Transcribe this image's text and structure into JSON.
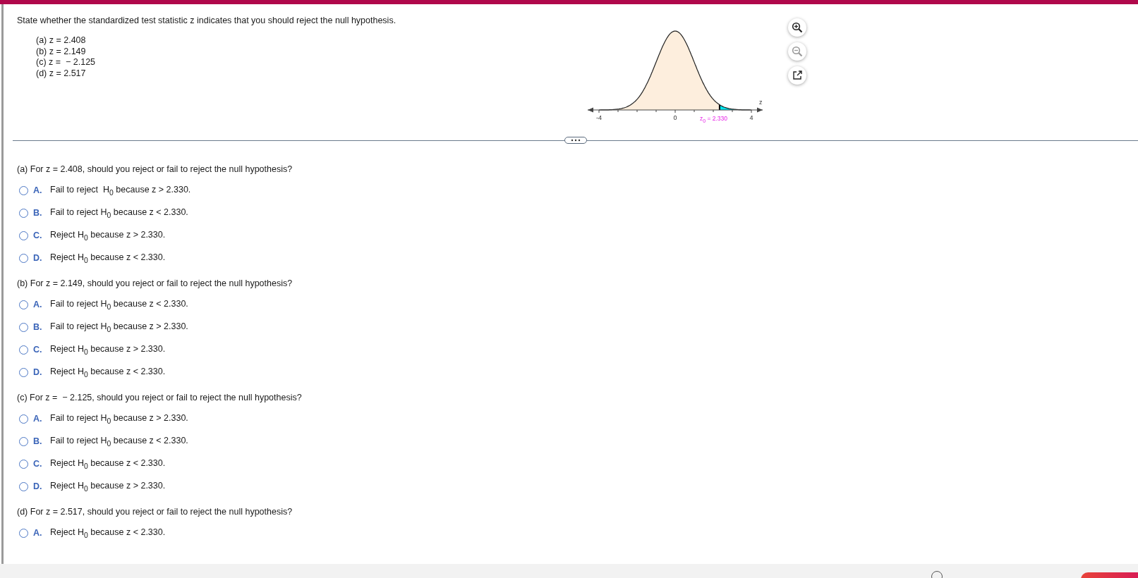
{
  "prompt": "State whether the standardized test statistic z indicates that you should reject the null hypothesis.",
  "given": [
    "(a) z = 2.408",
    "(b) z = 2.149",
    "(c) z =  − 2.125",
    "(d) z = 2.517"
  ],
  "figure": {
    "tick_labels": [
      "-4",
      "0",
      "4"
    ],
    "axis_label": "z",
    "critical_label": "z$_{0}$ = 2.330"
  },
  "tools": [
    {
      "kind": "zoom-in"
    },
    {
      "kind": "zoom-out"
    },
    {
      "kind": "popout"
    }
  ],
  "questions": [
    {
      "text": "(a) For z = 2.408, should you reject or fail to reject the null hypothesis?",
      "options": [
        {
          "letter": "A.",
          "text": "Fail to reject  H$_{0}$ because z > 2.330.",
          "selected": false
        },
        {
          "letter": "B.",
          "text": "Fail to reject H$_{0}$ because z < 2.330.",
          "selected": false
        },
        {
          "letter": "C.",
          "text": "Reject H$_{0}$ because z > 2.330.",
          "selected": false
        },
        {
          "letter": "D.",
          "text": "Reject H$_{0}$ because z < 2.330.",
          "selected": false
        }
      ]
    },
    {
      "text": "(b) For z = 2.149, should you reject or fail to reject the null hypothesis?",
      "options": [
        {
          "letter": "A.",
          "text": "Fail to reject H$_{0}$ because z < 2.330.",
          "selected": false
        },
        {
          "letter": "B.",
          "text": "Fail to reject H$_{0}$ because z > 2.330.",
          "selected": false
        },
        {
          "letter": "C.",
          "text": "Reject H$_{0}$ because z > 2.330.",
          "selected": false
        },
        {
          "letter": "D.",
          "text": "Reject H$_{0}$ because z < 2.330.",
          "selected": false
        }
      ]
    },
    {
      "text": "(c) For z =  − 2.125, should you reject or fail to reject the null hypothesis?",
      "options": [
        {
          "letter": "A.",
          "text": "Fail to reject H$_{0}$ because z > 2.330.",
          "selected": false
        },
        {
          "letter": "B.",
          "text": "Fail to reject H$_{0}$ because z < 2.330.",
          "selected": false
        },
        {
          "letter": "C.",
          "text": "Reject H$_{0}$ because z < 2.330.",
          "selected": false
        },
        {
          "letter": "D.",
          "text": "Reject H$_{0}$ because z > 2.330.",
          "selected": false
        }
      ]
    },
    {
      "text": "(d) For z = 2.517, should you reject or fail to reject the null hypothesis?",
      "options": [
        {
          "letter": "A.",
          "text": "Reject H$_{0}$ because z < 2.330.",
          "selected": false
        }
      ]
    }
  ]
}
